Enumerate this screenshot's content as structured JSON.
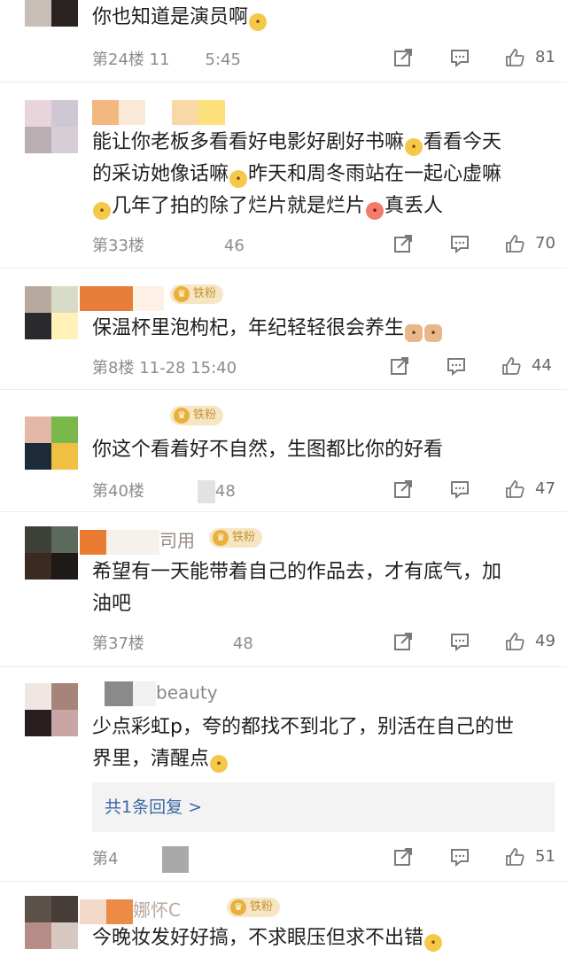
{
  "comments": [
    {
      "id": "c24",
      "text": "你也知道是演员啊",
      "floor": "第24楼",
      "time_fragment": "11",
      "time_tail": "5:45",
      "likes": "81"
    },
    {
      "id": "c33",
      "text_lines": [
        "能让你老板多看看好电影好剧好书嘛",
        "看看今天",
        "的采访她像话嘛",
        "昨天和周冬雨站在一起心虚嘛",
        "几年了拍的除了烂片就是烂片",
        "真丢人"
      ],
      "floor": "第33楼",
      "time_tail": "46",
      "likes": "70"
    },
    {
      "id": "c8",
      "badge": "铁粉",
      "text": "保温杯里泡枸杞，年纪轻轻很会养生",
      "floor": "第8楼",
      "time": "11-28 15:40",
      "likes": "44"
    },
    {
      "id": "c40",
      "badge": "铁粉",
      "text": "你这个看着好不自然，生图都比你的好看",
      "floor": "第40楼",
      "time_tail": "48",
      "likes": "47"
    },
    {
      "id": "c37",
      "username_fragment": "司用",
      "badge": "铁粉",
      "text_lines": [
        "希望有一天能带着自己的作品去，才有底气，加",
        "油吧"
      ],
      "floor": "第37楼",
      "time_tail": "48",
      "likes": "49"
    },
    {
      "id": "cb",
      "username_fragment": "beauty",
      "text_lines": [
        "少点彩虹p，夸的都找不到北了，别活在自己的世",
        "界里，清醒点"
      ],
      "reply_label": "共1条回复 >",
      "floor": "第4",
      "likes": "51"
    },
    {
      "id": "clast",
      "username_fragment": "娜怀C",
      "badge": "铁粉",
      "text": "今晚妆发好好搞，不求眼压但求不出错"
    }
  ]
}
